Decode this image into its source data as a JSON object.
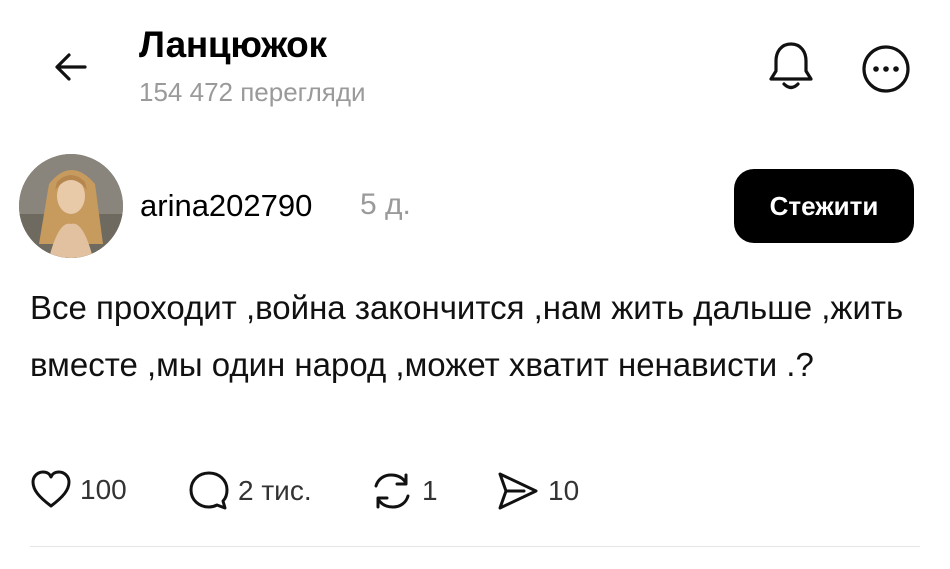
{
  "header": {
    "title": "Ланцюжок",
    "views": "154 472 перегляди",
    "icons": {
      "back": "arrow-left-icon",
      "notify": "bell-icon",
      "more": "more-horizontal-icon"
    }
  },
  "post": {
    "username": "arina202790",
    "time_ago": "5 д.",
    "follow_label": "Стежити",
    "text": "Все проходит ,война закончится ,нам жить дальше ,жить вместе ,мы один народ ,может хватит ненависти .?",
    "actions": {
      "likes": "100",
      "comments": "2 тис.",
      "reposts": "1",
      "shares": "10"
    }
  },
  "colors": {
    "accent": "#000000",
    "muted": "#9a9a9a",
    "background": "#ffffff"
  }
}
